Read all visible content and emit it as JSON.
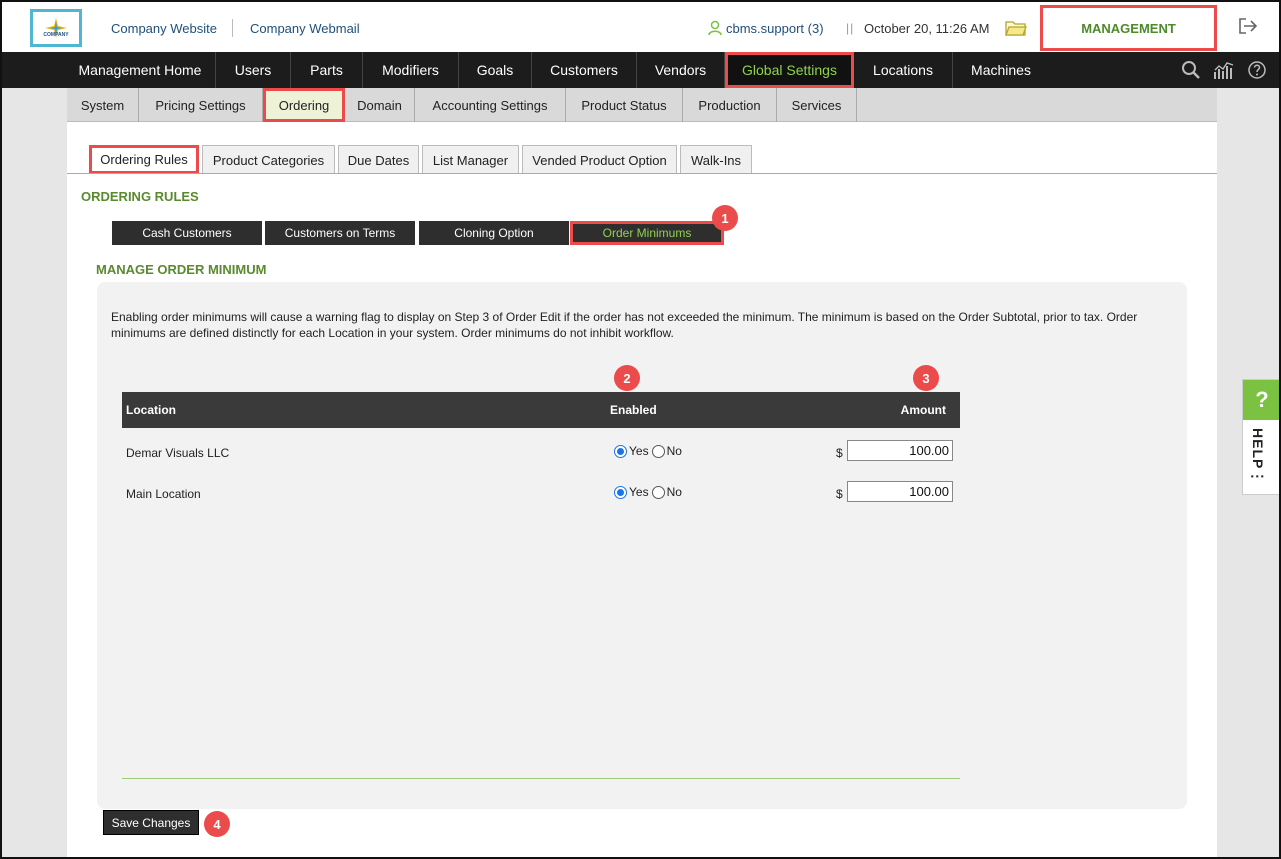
{
  "header": {
    "logo_text": "COMPANY",
    "links": [
      "Company Website",
      "Company Webmail"
    ],
    "user": "cbms.support (3)",
    "separator": "||",
    "datetime": "October 20, 11:26 AM",
    "management_label": "MANAGEMENT"
  },
  "main_nav": {
    "items": [
      "Management Home",
      "Users",
      "Parts",
      "Modifiers",
      "Goals",
      "Customers",
      "Vendors",
      "Global Settings",
      "Locations",
      "Machines"
    ],
    "active": "Global Settings"
  },
  "sub_nav": {
    "items": [
      "System",
      "Pricing Settings",
      "Ordering",
      "Domain",
      "Accounting Settings",
      "Product Status",
      "Production",
      "Services"
    ],
    "active": "Ordering"
  },
  "tabs": {
    "items": [
      "Ordering Rules",
      "Product Categories",
      "Due Dates",
      "List Manager",
      "Vended Product Option",
      "Walk-Ins"
    ],
    "active": "Ordering Rules"
  },
  "ordering_rules": {
    "title": "ORDERING RULES",
    "buttons": [
      "Cash Customers",
      "Customers on Terms",
      "Cloning Option",
      "Order Minimums"
    ],
    "active": "Order Minimums"
  },
  "manage": {
    "title": "MANAGE ORDER MINIMUM",
    "description": "Enabling order minimums will cause a warning flag to display on Step 3 of Order Edit if the order has not exceeded the minimum. The minimum is based on the Order Subtotal, prior to tax. Order minimums are defined distinctly for each Location in your system. Order minimums do not inhibit workflow.",
    "columns": {
      "location": "Location",
      "enabled": "Enabled",
      "amount": "Amount"
    },
    "yes_label": "Yes",
    "no_label": "No",
    "currency": "$",
    "rows": [
      {
        "location": "Demar Visuals LLC",
        "enabled": "Yes",
        "amount": "100.00"
      },
      {
        "location": "Main Location",
        "enabled": "Yes",
        "amount": "100.00"
      }
    ],
    "save_label": "Save Changes"
  },
  "badges": [
    "1",
    "2",
    "3",
    "4"
  ],
  "help": {
    "q": "?",
    "label": "HELP⋮"
  },
  "colors": {
    "accent_green": "#5a8a2e",
    "active_nav_text": "#8fd14f",
    "highlight_red": "#ec4b4b",
    "nav_bg": "#1c1c1c",
    "help_green": "#7bc142"
  }
}
